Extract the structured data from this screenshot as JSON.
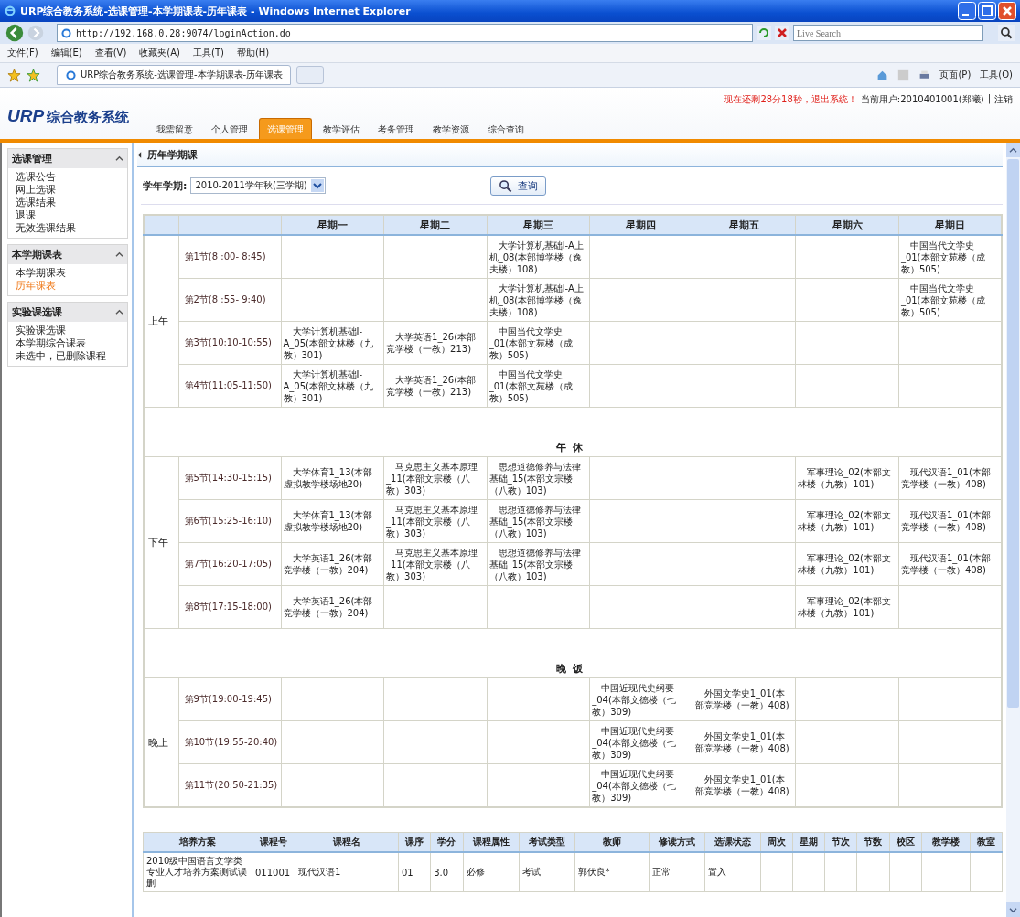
{
  "window": {
    "title": "URP综合教务系统-选课管理-本学期课表-历年课表 - Windows Internet Explorer"
  },
  "browser": {
    "address": "http://192.168.0.28:9074/loginAction.do",
    "search": {
      "placeholder": "Live Search"
    },
    "menu": [
      "文件(F)",
      "编辑(E)",
      "查看(V)",
      "收藏夹(A)",
      "工具(T)",
      "帮助(H)"
    ],
    "tab": {
      "title": "URP综合教务系统-选课管理-本学期课表-历年课表"
    },
    "command_bar": [
      "页面(P)",
      "工具(O)"
    ]
  },
  "header": {
    "logo_mark": "URP",
    "logo_text": "综合教务系统",
    "nav": [
      {
        "label": "我需留意",
        "selected": false
      },
      {
        "label": "个人管理",
        "selected": false
      },
      {
        "label": "选课管理",
        "selected": true
      },
      {
        "label": "教学评估",
        "selected": false
      },
      {
        "label": "考务管理",
        "selected": false
      },
      {
        "label": "教学资源",
        "selected": false
      },
      {
        "label": "综合查询",
        "selected": false
      }
    ],
    "session_notice": "现在还剩28分18秒，退出系统！",
    "user": "当前用户:2010401001(郑曦)",
    "separator": "|",
    "logout": "注销"
  },
  "sidebar": {
    "groups": [
      {
        "title": "选课管理",
        "expanded": true,
        "items": [
          {
            "label": "选课公告",
            "selected": false
          },
          {
            "label": "网上选课",
            "selected": false
          },
          {
            "label": "选课结果",
            "selected": false
          },
          {
            "label": "退课",
            "selected": false
          },
          {
            "label": "无效选课结果",
            "selected": false
          }
        ]
      },
      {
        "title": "本学期课表",
        "expanded": true,
        "items": [
          {
            "label": "本学期课表",
            "selected": false
          },
          {
            "label": "历年课表",
            "selected": true
          }
        ]
      },
      {
        "title": "实验课选课",
        "expanded": true,
        "items": [
          {
            "label": "实验课选课",
            "selected": false
          },
          {
            "label": "本学期综合课表",
            "selected": false
          },
          {
            "label": "未选中，已删除课程",
            "selected": false
          }
        ]
      }
    ]
  },
  "content": {
    "title": "历年学期课",
    "filter": {
      "label": "学年学期:",
      "value": "2010-2011学年秋(三学期)"
    },
    "query_button": "查询",
    "timetable": {
      "days": [
        "星期一",
        "星期二",
        "星期三",
        "星期四",
        "星期五",
        "星期六",
        "星期日"
      ],
      "rows": [
        {
          "kind": "block",
          "label": "上午",
          "periods": [
            {
              "label": "第1节(8 :00- 8:45)",
              "cells": [
                null,
                null,
                "大学计算机基础Ⅰ-A上机_08(本部博学楼（逸夫楼）108)",
                null,
                null,
                null,
                "中国当代文学史_01(本部文苑楼（成教）505)"
              ]
            },
            {
              "label": "第2节(8 :55- 9:40)",
              "cells": [
                null,
                null,
                "大学计算机基础Ⅰ-A上机_08(本部博学楼（逸夫楼）108)",
                null,
                null,
                null,
                "中国当代文学史_01(本部文苑楼（成教）505)"
              ]
            },
            {
              "label": "第3节(10:10-10:55)",
              "cells": [
                "大学计算机基础Ⅰ-A_05(本部文林楼（九教）301)",
                "大学英语1_26(本部竞学楼（一教）213)",
                "中国当代文学史_01(本部文苑楼（成教）505)",
                null,
                null,
                null,
                null
              ]
            },
            {
              "label": "第4节(11:05-11:50)",
              "cells": [
                "大学计算机基础Ⅰ-A_05(本部文林楼（九教）301)",
                "大学英语1_26(本部竞学楼（一教）213)",
                "中国当代文学史_01(本部文苑楼（成教）505)",
                null,
                null,
                null,
                null
              ]
            }
          ]
        },
        {
          "kind": "break",
          "label": "午休"
        },
        {
          "kind": "block",
          "label": "下午",
          "periods": [
            {
              "label": "第5节(14:30-15:15)",
              "cells": [
                "大学体育1_13(本部虚拟教学楼场地20)",
                "马克思主义基本原理_11(本部文宗楼（八教）303)",
                "思想道德修养与法律基础_15(本部文宗楼（八教）103)",
                null,
                null,
                "军事理论_02(本部文林楼（九教）101)",
                "现代汉语1_01(本部竞学楼（一教）408)"
              ]
            },
            {
              "label": "第6节(15:25-16:10)",
              "cells": [
                "大学体育1_13(本部虚拟教学楼场地20)",
                "马克思主义基本原理_11(本部文宗楼（八教）303)",
                "思想道德修养与法律基础_15(本部文宗楼（八教）103)",
                null,
                null,
                "军事理论_02(本部文林楼（九教）101)",
                "现代汉语1_01(本部竞学楼（一教）408)"
              ]
            },
            {
              "label": "第7节(16:20-17:05)",
              "cells": [
                "大学英语1_26(本部竞学楼（一教）204)",
                "马克思主义基本原理_11(本部文宗楼（八教）303)",
                "思想道德修养与法律基础_15(本部文宗楼（八教）103)",
                null,
                null,
                "军事理论_02(本部文林楼（九教）101)",
                "现代汉语1_01(本部竞学楼（一教）408)"
              ]
            },
            {
              "label": "第8节(17:15-18:00)",
              "cells": [
                "大学英语1_26(本部竞学楼（一教）204)",
                null,
                null,
                null,
                null,
                "军事理论_02(本部文林楼（九教）101)",
                null
              ]
            }
          ]
        },
        {
          "kind": "break",
          "label": "晚饭"
        },
        {
          "kind": "block",
          "label": "晚上",
          "periods": [
            {
              "label": "第9节(19:00-19:45)",
              "cells": [
                null,
                null,
                null,
                "中国近现代史纲要_04(本部文德楼（七教）309)",
                "外国文学史1_01(本部竞学楼（一教）408)",
                null,
                null
              ]
            },
            {
              "label": "第10节(19:55-20:40)",
              "cells": [
                null,
                null,
                null,
                "中国近现代史纲要_04(本部文德楼（七教）309)",
                "外国文学史1_01(本部竞学楼（一教）408)",
                null,
                null
              ]
            },
            {
              "label": "第11节(20:50-21:35)",
              "cells": [
                null,
                null,
                null,
                "中国近现代史纲要_04(本部文德楼（七教）309)",
                "外国文学史1_01(本部竞学楼（一教）408)",
                null,
                null
              ]
            }
          ]
        }
      ]
    },
    "course_table": {
      "columns": [
        "培养方案",
        "课程号",
        "课程名",
        "课序",
        "学分",
        "课程属性",
        "考试类型",
        "教师",
        "修读方式",
        "选课状态",
        "周次",
        "星期",
        "节次",
        "节数",
        "校区",
        "教学楼",
        "教室"
      ],
      "rows": [
        [
          "2010级中国语言文学类专业人才培养方案测试误删",
          "011001",
          "现代汉语1",
          "01",
          "3.0",
          "必修",
          "考试",
          "郭伏良*",
          "正常",
          "置入",
          null,
          null,
          null,
          null,
          null,
          null,
          null
        ]
      ]
    }
  }
}
